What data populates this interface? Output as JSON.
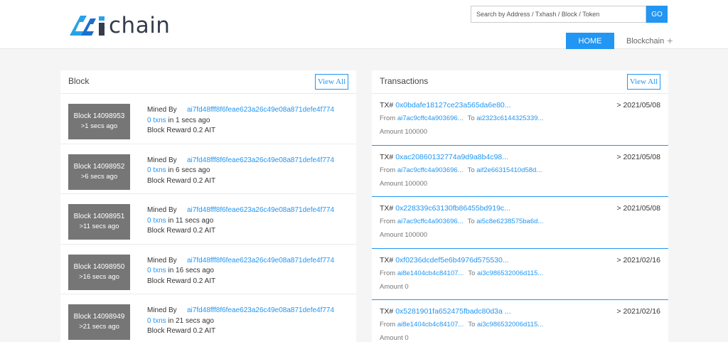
{
  "header": {
    "logo_text": "chain",
    "search_placeholder": "Search by Address / Txhash / Block / Token",
    "go_label": "GO",
    "nav": {
      "home_label": "HOME",
      "blockchain_label": "Blockchain",
      "plus_symbol": "+"
    }
  },
  "colors": {
    "accent": "#2196f3",
    "badge": "#767676",
    "logo_dark": "#333d4d"
  },
  "blocks_panel": {
    "title": "Block",
    "view_all_label": "View All",
    "mined_by_label": "Mined By",
    "in_label": "in",
    "items": [
      {
        "block_label": "Block 14098953",
        "age_short": ">1 secs ago",
        "miner": "ai7fd48fff8f6feae623a26c49e08a871defe4f774",
        "txns": "0 txns",
        "age": "1 secs ago",
        "reward": "Block Reward 0.2 AIT"
      },
      {
        "block_label": "Block 14098952",
        "age_short": ">6 secs ago",
        "miner": "ai7fd48fff8f6feae623a26c49e08a871defe4f774",
        "txns": "0 txns",
        "age": "6 secs ago",
        "reward": "Block Reward 0.2 AIT"
      },
      {
        "block_label": "Block 14098951",
        "age_short": ">11 secs ago",
        "miner": "ai7fd48fff8f6feae623a26c49e08a871defe4f774",
        "txns": "0 txns",
        "age": "11 secs ago",
        "reward": "Block Reward 0.2 AIT"
      },
      {
        "block_label": "Block 14098950",
        "age_short": ">16 secs ago",
        "miner": "ai7fd48fff8f6feae623a26c49e08a871defe4f774",
        "txns": "0 txns",
        "age": "16 secs ago",
        "reward": "Block Reward 0.2 AIT"
      },
      {
        "block_label": "Block 14098949",
        "age_short": ">21 secs ago",
        "miner": "ai7fd48fff8f6feae623a26c49e08a871defe4f774",
        "txns": "0 txns",
        "age": "21 secs ago",
        "reward": "Block Reward 0.2 AIT"
      }
    ]
  },
  "tx_panel": {
    "title": "Transactions",
    "view_all_label": "View All",
    "tx_prefix": "TX#",
    "from_label": "From",
    "to_label": "To",
    "items": [
      {
        "hash": "0x0bdafe18127ce23a565da6e80...",
        "date": "> 2021/05/08",
        "from": "ai7ac9cffc4a903696...",
        "to": "ai2323c6144325339...",
        "amount": "Amount 100000"
      },
      {
        "hash": "0xac20860132774a9d9a8b4c98...",
        "date": "> 2021/05/08",
        "from": "ai7ac9cffc4a903696...",
        "to": "aif2e66315410d58d...",
        "amount": "Amount 100000"
      },
      {
        "hash": "0x228339c63130fb86455bd919c...",
        "date": "> 2021/05/08",
        "from": "ai7ac9cffc4a903696...",
        "to": "ai5c8e6238575ba6d...",
        "amount": "Amount 100000"
      },
      {
        "hash": "0xf0236dcdef5e6b4976d575530...",
        "date": "> 2021/02/16",
        "from": "ai8e1404cb4c84107...",
        "to": "ai3c986532006d115...",
        "amount": "Amount 0"
      },
      {
        "hash": "0x5281901fa652475fbadc80d3a ...",
        "date": "> 2021/02/16",
        "from": "ai8e1404cb4c84107...",
        "to": "ai3c986532006d115...",
        "amount": "Amount 0"
      }
    ]
  }
}
